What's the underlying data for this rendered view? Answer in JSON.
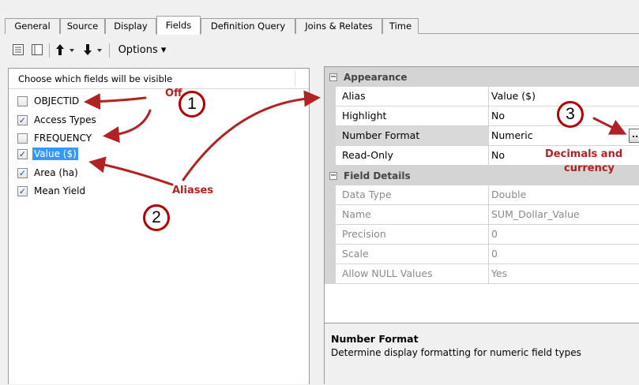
{
  "tabs": [
    {
      "label": "General"
    },
    {
      "label": "Source"
    },
    {
      "label": "Display"
    },
    {
      "label": "Fields",
      "active": true
    },
    {
      "label": "Definition Query"
    },
    {
      "label": "Joins & Relates"
    },
    {
      "label": "Time"
    }
  ],
  "toolbar": {
    "options_label": "Options ▾",
    "icons": [
      "table-view-icon",
      "list-view-icon",
      "move-up-icon",
      "move-down-icon"
    ]
  },
  "fields_panel": {
    "header": "Choose which fields will be visible",
    "fields": [
      {
        "label": "OBJECTID",
        "checked": false
      },
      {
        "label": "Access Types",
        "checked": true
      },
      {
        "label": "FREQUENCY",
        "checked": false
      },
      {
        "label": "Value ($)",
        "checked": true,
        "selected": true
      },
      {
        "label": "Area (ha)",
        "checked": true
      },
      {
        "label": "Mean Yield",
        "checked": true
      }
    ]
  },
  "properties": {
    "appearance": {
      "title": "Appearance",
      "rows": [
        {
          "name": "Alias",
          "value": "Value ($)"
        },
        {
          "name": "Highlight",
          "value": "No"
        },
        {
          "name": "Number Format",
          "value": "Numeric"
        },
        {
          "name": "Read-Only",
          "value": "No"
        }
      ]
    },
    "field_details": {
      "title": "Field Details",
      "rows": [
        {
          "name": "Data Type",
          "value": "Double"
        },
        {
          "name": "Name",
          "value": "SUM_Dollar_Value"
        },
        {
          "name": "Precision",
          "value": "0"
        },
        {
          "name": "Scale",
          "value": "0"
        },
        {
          "name": "Allow NULL Values",
          "value": "Yes"
        }
      ]
    },
    "ellipsis_label": "..",
    "expander_symbol": "−"
  },
  "help": {
    "title": "Number Format",
    "description": "Determine display formatting for numeric field types"
  },
  "annotations": {
    "off_label": "Off",
    "aliases_label": "Aliases",
    "decimals_line1": "Decimals and",
    "decimals_line2": "currency",
    "badge1": "1",
    "badge2": "2",
    "badge3": "3",
    "color": "#b22222"
  }
}
